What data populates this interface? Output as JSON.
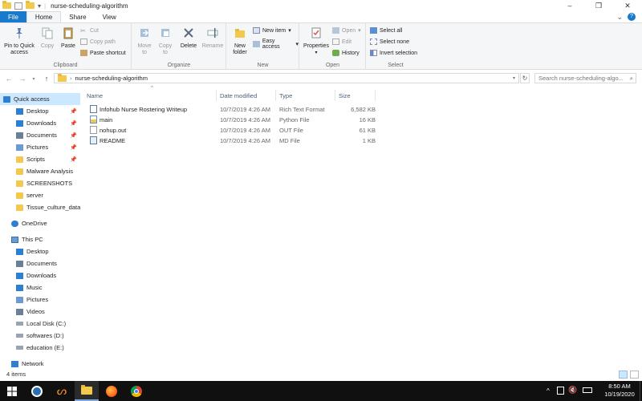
{
  "window": {
    "title": "nurse-scheduling-algorithm",
    "controls": {
      "minimize": "–",
      "maximize": "❐",
      "close": "✕"
    }
  },
  "ribbon_tabs": [
    "File",
    "Home",
    "Share",
    "View"
  ],
  "ribbon": {
    "clipboard": {
      "label": "Clipboard",
      "pin": "Pin to Quick access",
      "copy": "Copy",
      "paste": "Paste",
      "cut": "Cut",
      "copy_path": "Copy path",
      "paste_shortcut": "Paste shortcut"
    },
    "organize": {
      "label": "Organize",
      "move_to": "Move to",
      "copy_to": "Copy to",
      "delete": "Delete",
      "rename": "Rename"
    },
    "new": {
      "label": "New",
      "new_folder": "New folder",
      "new_item": "New item",
      "easy_access": "Easy access"
    },
    "open": {
      "label": "Open",
      "properties": "Properties",
      "open": "Open",
      "edit": "Edit",
      "history": "History"
    },
    "select": {
      "label": "Select",
      "select_all": "Select all",
      "select_none": "Select none",
      "invert": "Invert selection"
    }
  },
  "address": {
    "path": "nurse-scheduling-algorithm",
    "search_placeholder": "Search nurse-scheduling-algo..."
  },
  "nav": {
    "quick_access": "Quick access",
    "quick_items": [
      "Desktop",
      "Downloads",
      "Documents",
      "Pictures",
      "Scripts",
      "Malware Analysis",
      "SCREENSHOTS",
      "server",
      "Tissue_culture_data"
    ],
    "onedrive": "OneDrive",
    "this_pc": "This PC",
    "pc_items": [
      "Desktop",
      "Documents",
      "Downloads",
      "Music",
      "Pictures",
      "Videos",
      "Local Disk (C:)",
      "softwares (D:)",
      "education (E:)"
    ],
    "network": "Network"
  },
  "columns": {
    "name": "Name",
    "date": "Date modified",
    "type": "Type",
    "size": "Size"
  },
  "files": [
    {
      "name": "Infohub Nurse Rostering Writeup",
      "date": "10/7/2019 4:26 AM",
      "type": "Rich Text Format",
      "size": "6,582 KB"
    },
    {
      "name": "main",
      "date": "10/7/2019 4:26 AM",
      "type": "Python File",
      "size": "16 KB"
    },
    {
      "name": "nohup.out",
      "date": "10/7/2019 4:26 AM",
      "type": "OUT File",
      "size": "61 KB"
    },
    {
      "name": "README",
      "date": "10/7/2019 4:26 AM",
      "type": "MD File",
      "size": "1 KB"
    }
  ],
  "status": {
    "items": "4 items"
  },
  "taskbar": {
    "time": "8:50 AM",
    "date": "10/19/2020"
  },
  "colors": {
    "accent": "#1979ca",
    "selected": "#cce8ff",
    "taskbar": "#101010"
  }
}
